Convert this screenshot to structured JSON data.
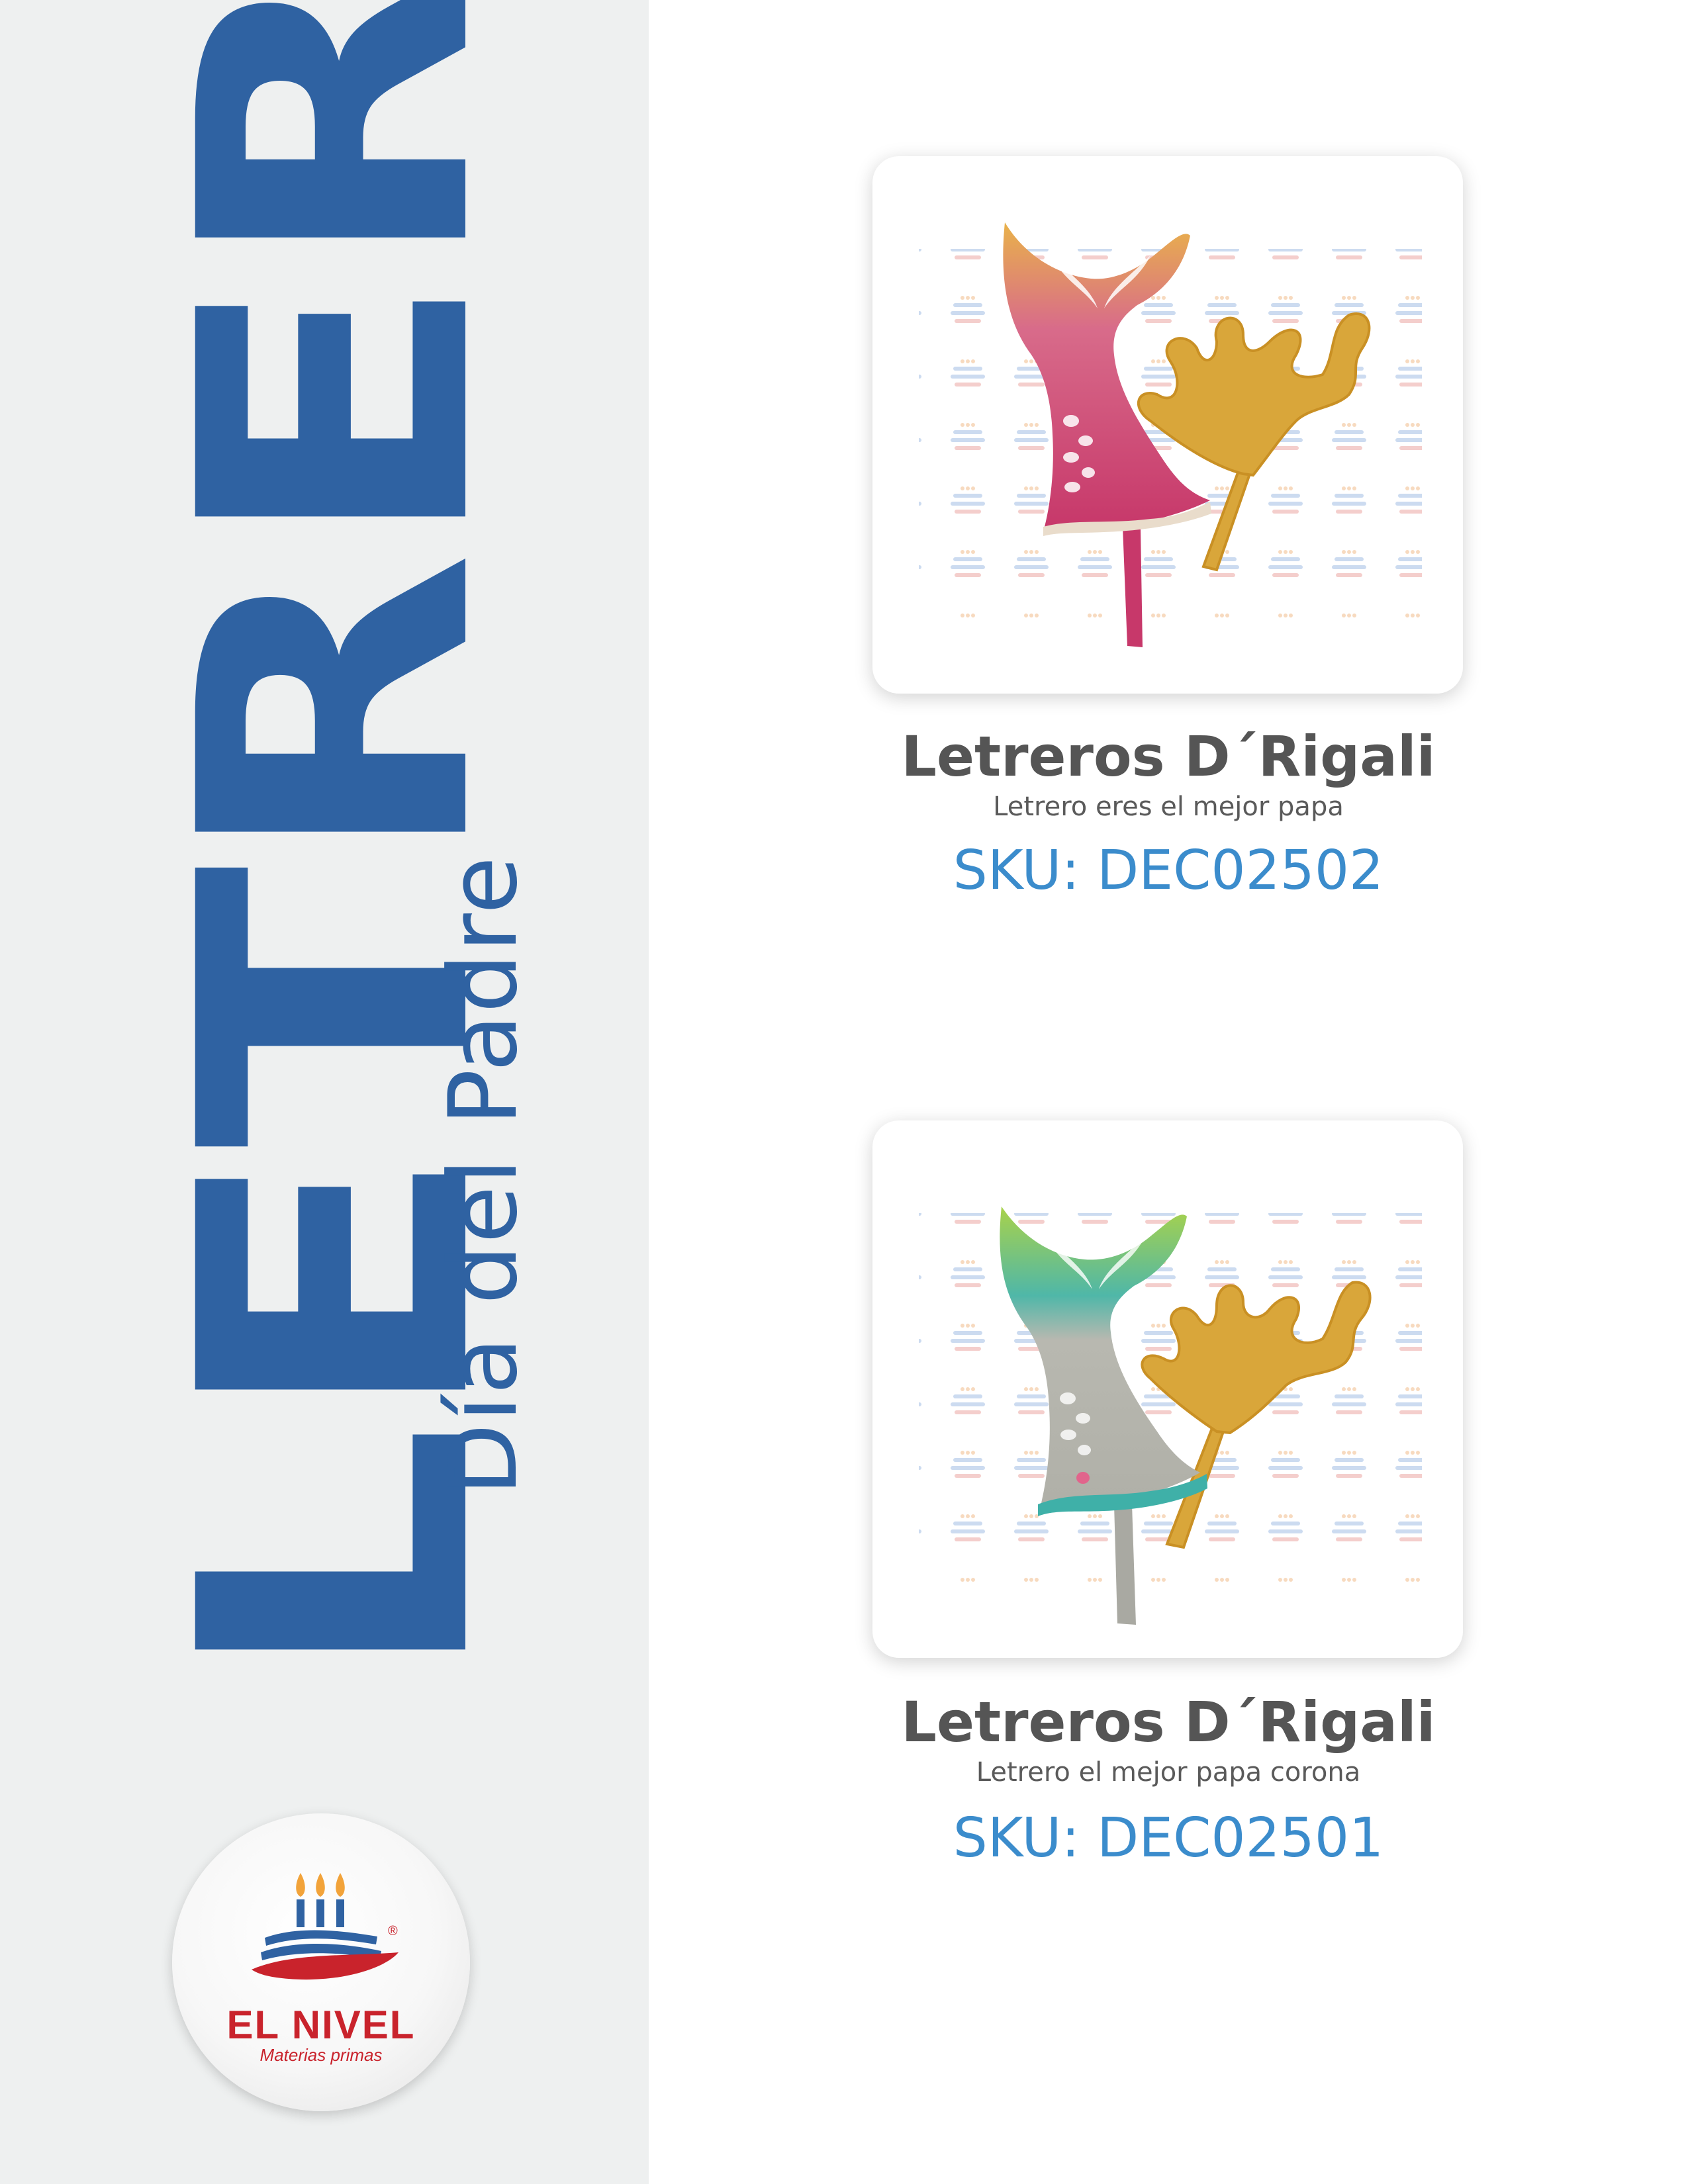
{
  "sidebar": {
    "title": "LETREROS",
    "subtitle": "Día del Padre",
    "colors": {
      "accent": "#2f62a2",
      "panel": "#eef0f0"
    }
  },
  "logo": {
    "name": "EL NIVEL",
    "tagline": "Materias primas",
    "registered_mark": "®",
    "colors": {
      "red": "#c9232c",
      "blue": "#2f62a2",
      "candle_flame": "#f2a33a"
    }
  },
  "products": [
    {
      "name": "Letreros D´Rigali",
      "description": "Letrero eres el mejor papa",
      "sku": "SKU: DEC02502",
      "image": "mermaid-tail-and-coral-topper-pink",
      "colors": {
        "tail_top": "#e9b24a",
        "tail_body": "#c7386a",
        "coral": "#d9a63a"
      }
    },
    {
      "name": "Letreros D´Rigali",
      "description": "Letrero el mejor papa corona",
      "sku": "SKU: DEC02501",
      "image": "mermaid-tail-and-coral-topper-silver",
      "colors": {
        "tail_top": "#a9d24a",
        "tail_body": "#b8b8b0",
        "coral": "#d9a63a"
      }
    }
  ],
  "sku_color": "#3b8ccc"
}
